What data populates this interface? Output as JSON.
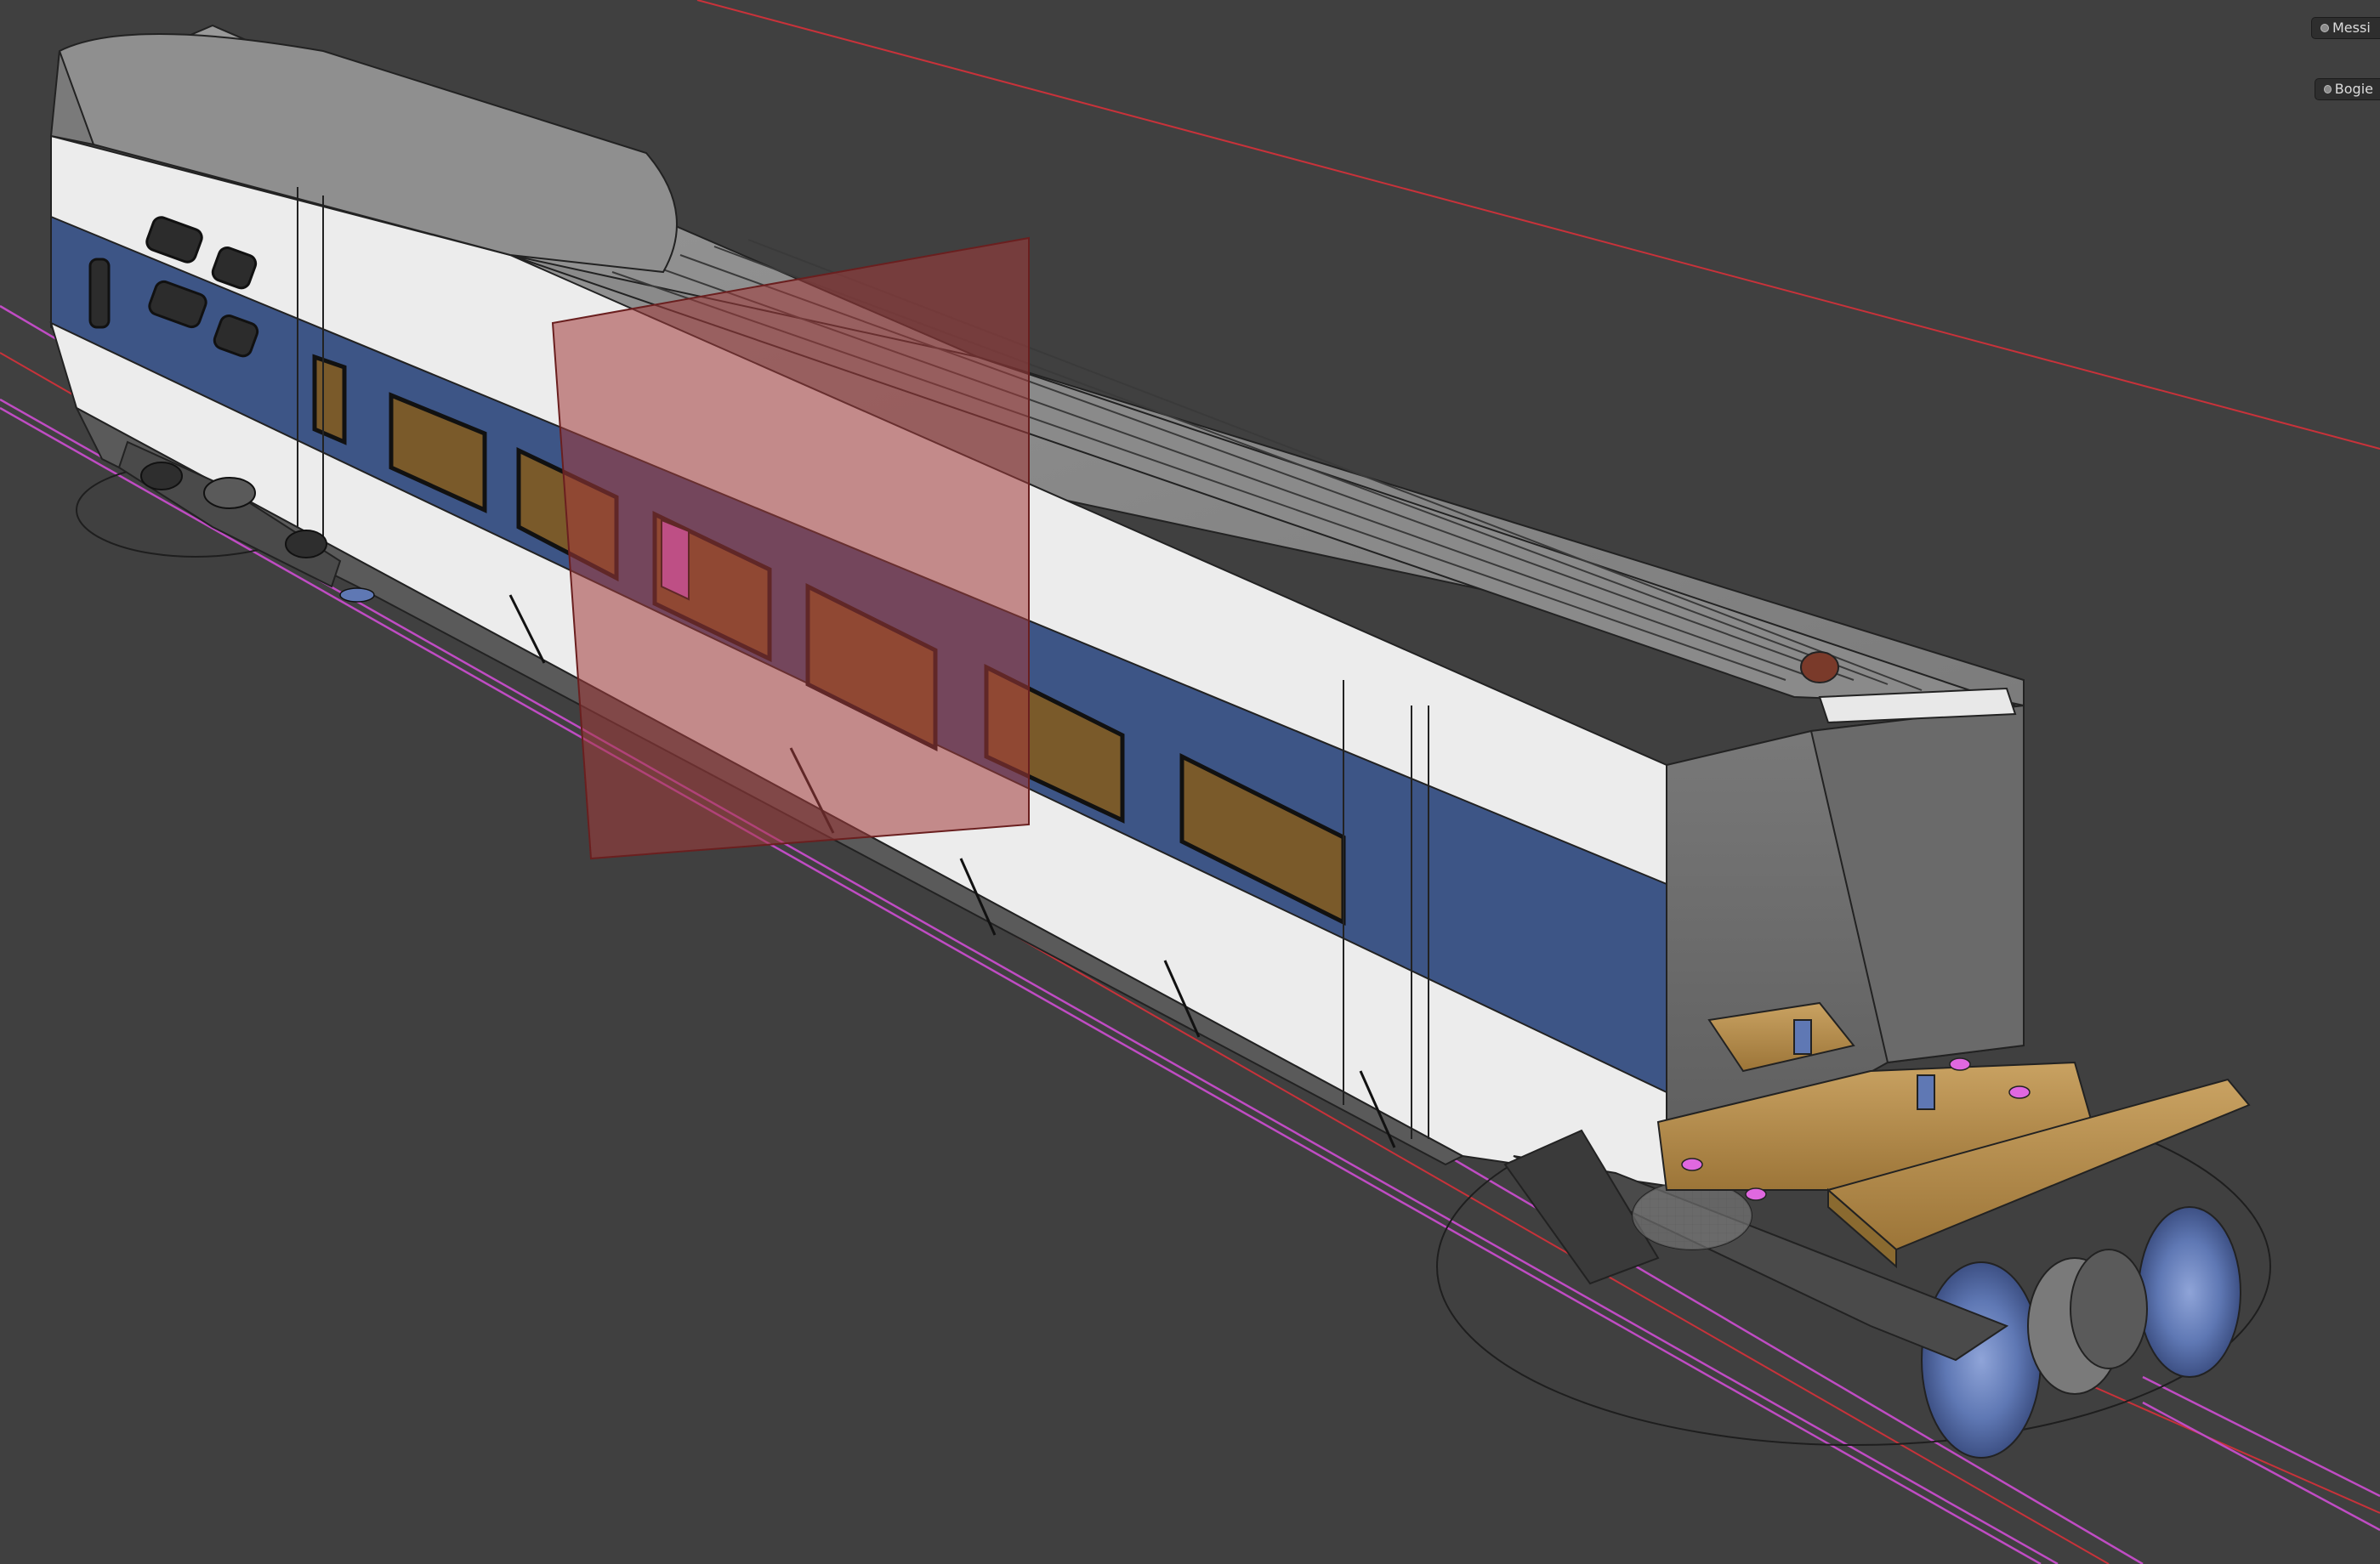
{
  "viewport": {
    "background": "#404040",
    "subject": "train-car-3d-model",
    "object_tags": [
      {
        "label": "Messi",
        "icon": "object-dot-icon"
      },
      {
        "label": "Bogie",
        "icon": "object-dot-icon"
      }
    ]
  },
  "colors": {
    "body_white": "#ececec",
    "stripe_blue": "#3d5586",
    "roof_grey": "#8e8e8e",
    "section_plane": "#a23a3a",
    "bogie_gold": "#b8904e",
    "wheel_blue": "#5f78b4",
    "rail_magenta": "#c04cc4",
    "guide_red": "#c8323a",
    "interior_brown": "#7a5a2a",
    "highlight_magenta": "#e068e0"
  }
}
